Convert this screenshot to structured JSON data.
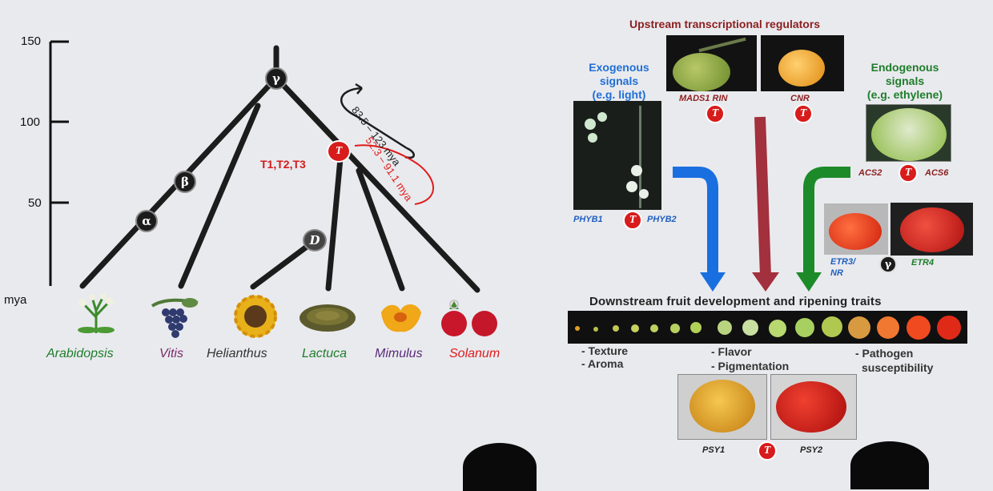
{
  "timeline": {
    "ticks": [
      "150",
      "100",
      "50"
    ],
    "unit_label": "mya"
  },
  "tree": {
    "nodes": {
      "gamma": "γ",
      "beta": "β",
      "alpha": "α",
      "d": "D",
      "t": "T"
    },
    "wgt_label": "T1,T2,T3",
    "range_black": "83.5 – 123 mya",
    "range_red": "52.3 – 91.1 mya"
  },
  "species": [
    {
      "name": "Arabidopsis",
      "color": "#1e7d2a"
    },
    {
      "name": "Vitis",
      "color": "#7a2a6a"
    },
    {
      "name": "Helianthus",
      "color": "#333333"
    },
    {
      "name": "Lactuca",
      "color": "#1e7d2a"
    },
    {
      "name": "Mimulus",
      "color": "#5a2a7a"
    },
    {
      "name": "Solanum",
      "color": "#e11b1b"
    }
  ],
  "pathway": {
    "upstream_title": "Upstream transcriptional regulators",
    "exogenous": [
      "Exogenous",
      "signals",
      "(e.g. light)"
    ],
    "endogenous": [
      "Endogenous",
      "signals",
      "(e.g. ethylene)"
    ],
    "genes": {
      "mads_rin": "MADS1 RIN",
      "cnr": "CNR",
      "phyb1": "PHYB1",
      "phyb2": "PHYB2",
      "acs2": "ACS2",
      "acs6": "ACS6",
      "etr3": "ETR3/",
      "nr": "NR",
      "etr4": "ETR4",
      "psy1": "PSY1",
      "psy2": "PSY2"
    },
    "t_badge": "T",
    "gamma_badge": "γ",
    "downstream_title": "Downstream fruit development and ripening traits",
    "traits": {
      "texture": "- Texture",
      "aroma": "- Aroma",
      "flavor": "- Flavor",
      "pigmentation": "- Pigmentation",
      "pathogen": "- Pathogen",
      "susceptibility": "susceptibility"
    }
  },
  "colors": {
    "blue_arrow": "#1a6fe0",
    "red_arrow": "#a3303d",
    "green_arrow": "#1d8a2a",
    "t_badge": "#d81b1b"
  }
}
